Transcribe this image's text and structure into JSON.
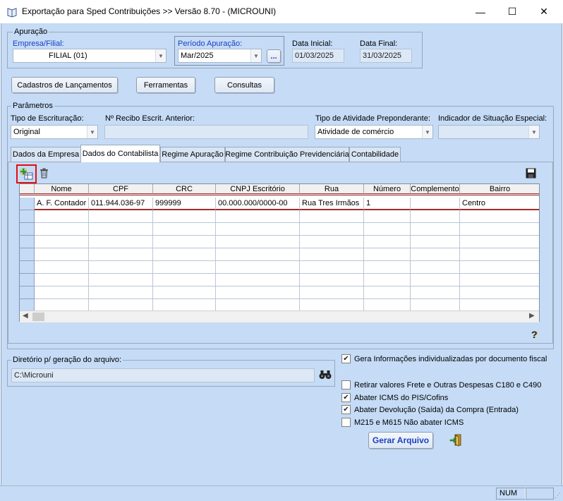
{
  "window": {
    "title": "Exportação para Sped Contribuições >> Versão 8.70 - (MICROUNI)",
    "minimize": "—",
    "maximize": "☐",
    "close": "✕"
  },
  "apuracao": {
    "legend": "Apuração",
    "empresa_label": "Empresa/Filial:",
    "empresa_value": "FILIAL (01)",
    "periodo_label": "Período Apuração:",
    "periodo_value": "Mar/2025",
    "periodo_button": "...",
    "data_inicial_label": "Data Inicial:",
    "data_inicial_value": "01/03/2025",
    "data_final_label": "Data Final:",
    "data_final_value": "31/03/2025"
  },
  "toolbar": {
    "cadastros": "Cadastros de Lançamentos",
    "ferramentas": "Ferramentas",
    "consultas": "Consultas"
  },
  "parametros": {
    "legend": "Parâmetros",
    "tipo_escrituracao_label": "Tipo de Escrituração:",
    "tipo_escrituracao_value": "Original",
    "recibo_label": "Nº Recibo Escrit. Anterior:",
    "recibo_value": "",
    "atividade_label": "Tipo de Atividade Preponderante:",
    "atividade_value": "Atividade de comércio",
    "situacao_label": "Indicador de Situação Especial:",
    "situacao_value": ""
  },
  "tabs": [
    {
      "label": "Dados da Empresa"
    },
    {
      "label": "Dados do Contabilista"
    },
    {
      "label": "Regime Apuração"
    },
    {
      "label": "Regime Contribuição Previdenciária"
    },
    {
      "label": "Contabilidade"
    }
  ],
  "grid": {
    "columns": [
      "Nome",
      "CPF",
      "CRC",
      "CNPJ Escritório",
      "Rua",
      "Número",
      "Complemento",
      "Bairro"
    ],
    "rows": [
      [
        "A. F. Contador",
        "011.944.036-97",
        "999999",
        "00.000.000/0000-00",
        "Rua Tres Irmãos",
        "1",
        "",
        "Centro"
      ]
    ]
  },
  "diretorio": {
    "legend": "Diretório p/ geração do arquivo:",
    "value": "C:\\Microuni"
  },
  "options": [
    {
      "label": "Gera Informações individualizadas por documento fiscal",
      "checked": true
    },
    {
      "label": "Retirar valores Frete e Outras Despesas C180 e C490",
      "checked": false
    },
    {
      "label": "Abater ICMS do PIS/Cofins",
      "checked": true
    },
    {
      "label": "Abater Devolução (Saída) da Compra (Entrada)",
      "checked": true
    },
    {
      "label": "M215 e M615 Não abater ICMS",
      "checked": false
    }
  ],
  "gerar_button": "Gerar Arquivo",
  "status": {
    "num": "NUM"
  },
  "colors": {
    "window_bg": "#c5dbf6",
    "accent_label": "#1a3fc4",
    "highlight_box": "#e01010"
  }
}
